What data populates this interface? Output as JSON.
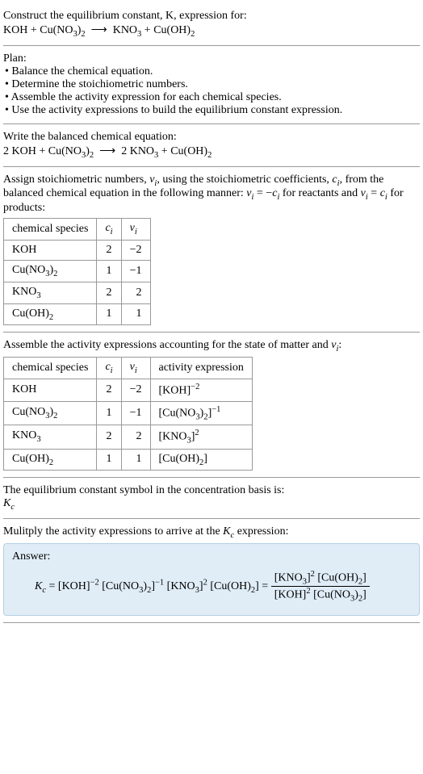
{
  "s1": {
    "line1": "Construct the equilibrium constant, K, expression for:",
    "eq": "KOH + Cu(NO₃)₂ ⟶ KNO₃ + Cu(OH)₂"
  },
  "s2": {
    "heading": "Plan:",
    "b1": "• Balance the chemical equation.",
    "b2": "• Determine the stoichiometric numbers.",
    "b3": "• Assemble the activity expression for each chemical species.",
    "b4": "• Use the activity expressions to build the equilibrium constant expression."
  },
  "s3": {
    "line1": "Write the balanced chemical equation:",
    "eq": "2 KOH + Cu(NO₃)₂ ⟶ 2 KNO₃ + Cu(OH)₂"
  },
  "s4": {
    "line1_a": "Assign stoichiometric numbers, ",
    "line1_b": ", using the stoichiometric coefficients, ",
    "line1_c": ", from the balanced chemical equation in the following manner: ",
    "line1_d": " for reactants and ",
    "line1_e": " for products:",
    "h1": "chemical species",
    "r1c1": "KOH",
    "r1c2": "2",
    "r1c3": "−2",
    "r2c1": "Cu(NO₃)₂",
    "r2c2": "1",
    "r2c3": "−1",
    "r3c1": "KNO₃",
    "r3c2": "2",
    "r3c3": "2",
    "r4c1": "Cu(OH)₂",
    "r4c2": "1",
    "r4c3": "1"
  },
  "s5": {
    "line1_a": "Assemble the activity expressions accounting for the state of matter and ",
    "line1_b": ":",
    "h1": "chemical species",
    "h4": "activity expression",
    "r1c1": "KOH",
    "r1c2": "2",
    "r1c3": "−2",
    "r2c1": "Cu(NO₃)₂",
    "r2c2": "1",
    "r2c3": "−1",
    "r3c1": "KNO₃",
    "r3c2": "2",
    "r3c3": "2",
    "r4c1": "Cu(OH)₂",
    "r4c2": "1",
    "r4c3": "1"
  },
  "s6": {
    "line1": "The equilibrium constant symbol in the concentration basis is:"
  },
  "s7": {
    "line1_a": "Mulitply the activity expressions to arrive at the ",
    "line1_b": " expression:"
  },
  "answer": {
    "label": "Answer:"
  }
}
